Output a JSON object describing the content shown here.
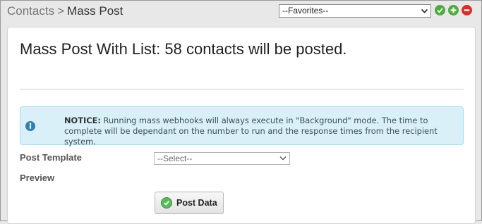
{
  "header": {
    "breadcrumb_root": "Contacts",
    "breadcrumb_separator": ">",
    "breadcrumb_current": "Mass Post",
    "favorites_selected": "--Favorites--",
    "accent_green": "#4caa3e",
    "accent_red": "#d4312c"
  },
  "main": {
    "title": "Mass Post With List: 58 contacts will be posted.",
    "notice": {
      "label": "NOTICE:",
      "text": "Running mass webhooks will always execute in \"Background\" mode. The time to complete will be dependant on the number to run and the response times from the recipient system.",
      "icon": "info-icon"
    },
    "post_template_label": "Post Template",
    "post_template_selected": "--Select--",
    "preview_label": "Preview",
    "post_button_label": "Post Data"
  }
}
